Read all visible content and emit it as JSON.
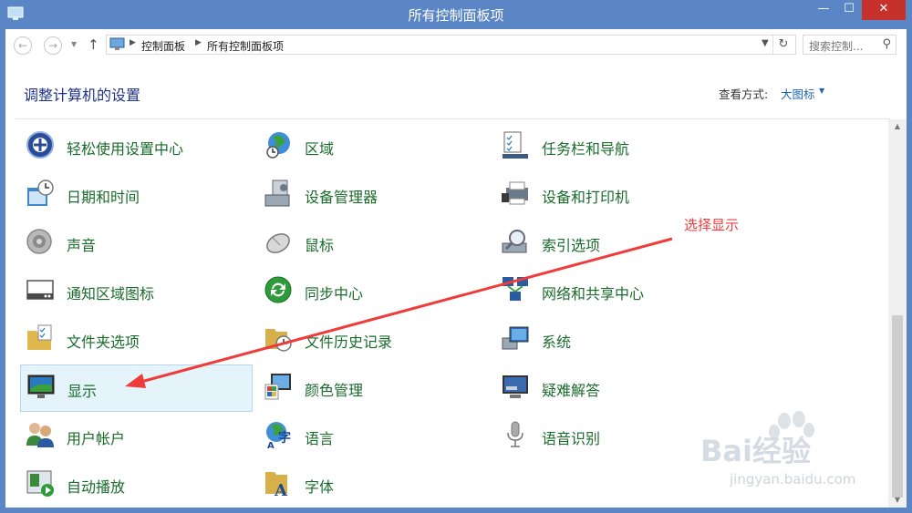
{
  "window": {
    "title": "所有控制面板项",
    "close_icon": "close-icon",
    "minimize_icon": "minimize-icon",
    "maximize_icon": "maximize-icon"
  },
  "nav": {
    "breadcrumbs": [
      "控制面板",
      "所有控制面板项"
    ],
    "search_placeholder": "搜索控制..."
  },
  "header": {
    "title": "调整计算机的设置",
    "view_label": "查看方式:",
    "view_value": "大图标"
  },
  "items": [
    {
      "label": "轻松使用设置中心",
      "icon": "ease-of-access-icon",
      "color": "#2a4c9a"
    },
    {
      "label": "区域",
      "icon": "region-globe-icon",
      "color": "#2f8a3c"
    },
    {
      "label": "任务栏和导航",
      "icon": "taskbar-icon",
      "color": "#3b5b80"
    },
    {
      "label": "日期和时间",
      "icon": "date-time-icon",
      "color": "#3f87c8"
    },
    {
      "label": "设备管理器",
      "icon": "device-manager-icon",
      "color": "#7a8a9a"
    },
    {
      "label": "设备和打印机",
      "icon": "printer-icon",
      "color": "#5a6a7a"
    },
    {
      "label": "声音",
      "icon": "speaker-icon",
      "color": "#9a9a9a"
    },
    {
      "label": "鼠标",
      "icon": "mouse-icon",
      "color": "#8a8a8a"
    },
    {
      "label": "索引选项",
      "icon": "index-options-icon",
      "color": "#8a9aa8"
    },
    {
      "label": "通知区域图标",
      "icon": "notification-area-icon",
      "color": "#4a4a4a"
    },
    {
      "label": "同步中心",
      "icon": "sync-center-icon",
      "color": "#2e9b3a"
    },
    {
      "label": "网络和共享中心",
      "icon": "network-icon",
      "color": "#2a5aa0"
    },
    {
      "label": "文件夹选项",
      "icon": "folder-options-icon",
      "color": "#e1b84e"
    },
    {
      "label": "文件历史记录",
      "icon": "file-history-icon",
      "color": "#d8b04a"
    },
    {
      "label": "系统",
      "icon": "system-icon",
      "color": "#2a6ab8"
    },
    {
      "label": "显示",
      "icon": "display-icon",
      "color": "#2a7ac0"
    },
    {
      "label": "颜色管理",
      "icon": "color-management-icon",
      "color": "#c84a3a"
    },
    {
      "label": "疑难解答",
      "icon": "troubleshooting-icon",
      "color": "#3a6ab0"
    },
    {
      "label": "用户帐户",
      "icon": "user-accounts-icon",
      "color": "#3b8a3b"
    },
    {
      "label": "语言",
      "icon": "language-icon",
      "color": "#2a6ab8"
    },
    {
      "label": "语音识别",
      "icon": "microphone-icon",
      "color": "#8a8a8a"
    },
    {
      "label": "自动播放",
      "icon": "autoplay-icon",
      "color": "#3a8a3a"
    },
    {
      "label": "字体",
      "icon": "fonts-icon",
      "color": "#d8b04a"
    }
  ],
  "annotation": {
    "text": "选择显示",
    "color": "#f03b3b"
  },
  "watermark": {
    "text": "Bai经验",
    "sub": "jingyan.baidu.com"
  }
}
